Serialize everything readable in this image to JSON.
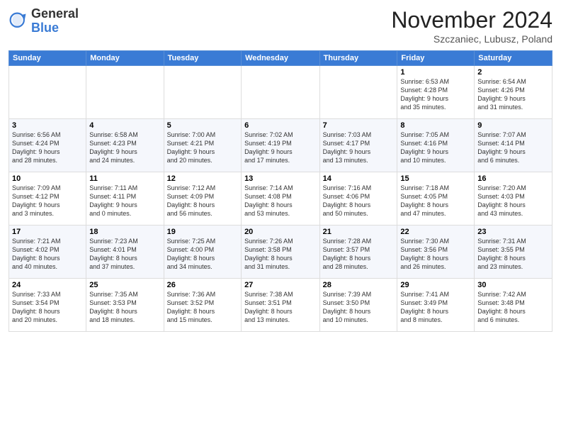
{
  "logo": {
    "general": "General",
    "blue": "Blue"
  },
  "title": "November 2024",
  "location": "Szczaniec, Lubusz, Poland",
  "days_header": [
    "Sunday",
    "Monday",
    "Tuesday",
    "Wednesday",
    "Thursday",
    "Friday",
    "Saturday"
  ],
  "weeks": [
    [
      {
        "day": "",
        "info": ""
      },
      {
        "day": "",
        "info": ""
      },
      {
        "day": "",
        "info": ""
      },
      {
        "day": "",
        "info": ""
      },
      {
        "day": "",
        "info": ""
      },
      {
        "day": "1",
        "info": "Sunrise: 6:53 AM\nSunset: 4:28 PM\nDaylight: 9 hours\nand 35 minutes."
      },
      {
        "day": "2",
        "info": "Sunrise: 6:54 AM\nSunset: 4:26 PM\nDaylight: 9 hours\nand 31 minutes."
      }
    ],
    [
      {
        "day": "3",
        "info": "Sunrise: 6:56 AM\nSunset: 4:24 PM\nDaylight: 9 hours\nand 28 minutes."
      },
      {
        "day": "4",
        "info": "Sunrise: 6:58 AM\nSunset: 4:23 PM\nDaylight: 9 hours\nand 24 minutes."
      },
      {
        "day": "5",
        "info": "Sunrise: 7:00 AM\nSunset: 4:21 PM\nDaylight: 9 hours\nand 20 minutes."
      },
      {
        "day": "6",
        "info": "Sunrise: 7:02 AM\nSunset: 4:19 PM\nDaylight: 9 hours\nand 17 minutes."
      },
      {
        "day": "7",
        "info": "Sunrise: 7:03 AM\nSunset: 4:17 PM\nDaylight: 9 hours\nand 13 minutes."
      },
      {
        "day": "8",
        "info": "Sunrise: 7:05 AM\nSunset: 4:16 PM\nDaylight: 9 hours\nand 10 minutes."
      },
      {
        "day": "9",
        "info": "Sunrise: 7:07 AM\nSunset: 4:14 PM\nDaylight: 9 hours\nand 6 minutes."
      }
    ],
    [
      {
        "day": "10",
        "info": "Sunrise: 7:09 AM\nSunset: 4:12 PM\nDaylight: 9 hours\nand 3 minutes."
      },
      {
        "day": "11",
        "info": "Sunrise: 7:11 AM\nSunset: 4:11 PM\nDaylight: 9 hours\nand 0 minutes."
      },
      {
        "day": "12",
        "info": "Sunrise: 7:12 AM\nSunset: 4:09 PM\nDaylight: 8 hours\nand 56 minutes."
      },
      {
        "day": "13",
        "info": "Sunrise: 7:14 AM\nSunset: 4:08 PM\nDaylight: 8 hours\nand 53 minutes."
      },
      {
        "day": "14",
        "info": "Sunrise: 7:16 AM\nSunset: 4:06 PM\nDaylight: 8 hours\nand 50 minutes."
      },
      {
        "day": "15",
        "info": "Sunrise: 7:18 AM\nSunset: 4:05 PM\nDaylight: 8 hours\nand 47 minutes."
      },
      {
        "day": "16",
        "info": "Sunrise: 7:20 AM\nSunset: 4:03 PM\nDaylight: 8 hours\nand 43 minutes."
      }
    ],
    [
      {
        "day": "17",
        "info": "Sunrise: 7:21 AM\nSunset: 4:02 PM\nDaylight: 8 hours\nand 40 minutes."
      },
      {
        "day": "18",
        "info": "Sunrise: 7:23 AM\nSunset: 4:01 PM\nDaylight: 8 hours\nand 37 minutes."
      },
      {
        "day": "19",
        "info": "Sunrise: 7:25 AM\nSunset: 4:00 PM\nDaylight: 8 hours\nand 34 minutes."
      },
      {
        "day": "20",
        "info": "Sunrise: 7:26 AM\nSunset: 3:58 PM\nDaylight: 8 hours\nand 31 minutes."
      },
      {
        "day": "21",
        "info": "Sunrise: 7:28 AM\nSunset: 3:57 PM\nDaylight: 8 hours\nand 28 minutes."
      },
      {
        "day": "22",
        "info": "Sunrise: 7:30 AM\nSunset: 3:56 PM\nDaylight: 8 hours\nand 26 minutes."
      },
      {
        "day": "23",
        "info": "Sunrise: 7:31 AM\nSunset: 3:55 PM\nDaylight: 8 hours\nand 23 minutes."
      }
    ],
    [
      {
        "day": "24",
        "info": "Sunrise: 7:33 AM\nSunset: 3:54 PM\nDaylight: 8 hours\nand 20 minutes."
      },
      {
        "day": "25",
        "info": "Sunrise: 7:35 AM\nSunset: 3:53 PM\nDaylight: 8 hours\nand 18 minutes."
      },
      {
        "day": "26",
        "info": "Sunrise: 7:36 AM\nSunset: 3:52 PM\nDaylight: 8 hours\nand 15 minutes."
      },
      {
        "day": "27",
        "info": "Sunrise: 7:38 AM\nSunset: 3:51 PM\nDaylight: 8 hours\nand 13 minutes."
      },
      {
        "day": "28",
        "info": "Sunrise: 7:39 AM\nSunset: 3:50 PM\nDaylight: 8 hours\nand 10 minutes."
      },
      {
        "day": "29",
        "info": "Sunrise: 7:41 AM\nSunset: 3:49 PM\nDaylight: 8 hours\nand 8 minutes."
      },
      {
        "day": "30",
        "info": "Sunrise: 7:42 AM\nSunset: 3:48 PM\nDaylight: 8 hours\nand 6 minutes."
      }
    ]
  ]
}
